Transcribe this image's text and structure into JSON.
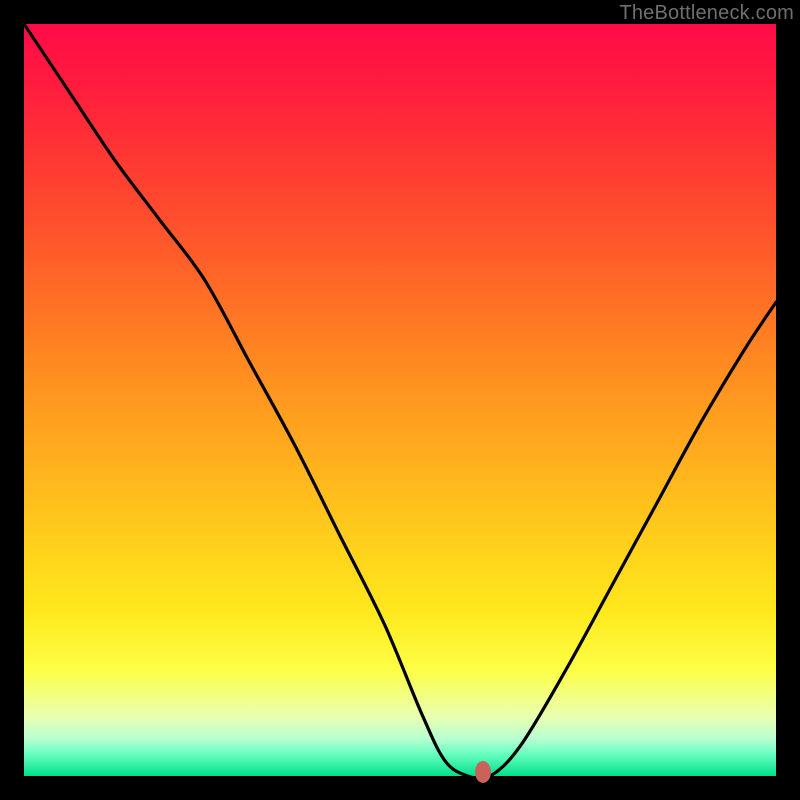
{
  "watermark": {
    "text": "TheBottleneck.com"
  },
  "colors": {
    "page_bg": "#000000",
    "curve_stroke": "#000000",
    "marker_fill": "#c9635a",
    "gradient": [
      "#ff0b47",
      "#ff1c3f",
      "#ff3833",
      "#ff5a2a",
      "#ff8022",
      "#ffa41e",
      "#ffc71c",
      "#ffe81c",
      "#fdff47",
      "#eaffb0",
      "#b8ffd0",
      "#6bffc0",
      "#00e08b"
    ]
  },
  "chart_data": {
    "type": "line",
    "title": "",
    "xlabel": "",
    "ylabel": "",
    "xlim": [
      0,
      100
    ],
    "ylim": [
      0,
      100
    ],
    "grid": false,
    "legend": false,
    "series": [
      {
        "name": "curve",
        "x": [
          0,
          6,
          12,
          18,
          24,
          30,
          36,
          42,
          48,
          53,
          56,
          59,
          62,
          66,
          72,
          78,
          84,
          90,
          96,
          100
        ],
        "values": [
          100,
          91,
          82,
          74,
          66,
          55,
          44,
          32,
          20,
          8,
          2,
          0,
          0,
          4,
          14,
          25,
          36,
          47,
          57,
          63
        ]
      }
    ],
    "marker": {
      "x": 61,
      "y": 0.5
    },
    "flat_bottom": {
      "x_start": 57,
      "x_end": 62,
      "y": 0
    },
    "notes": "Axes are not labeled in the source image; values are estimated on a 0-100 normalized scale from pixel positions. 'values' = vertical position where 0 is the bottom (green) and 100 is the top (red)."
  }
}
